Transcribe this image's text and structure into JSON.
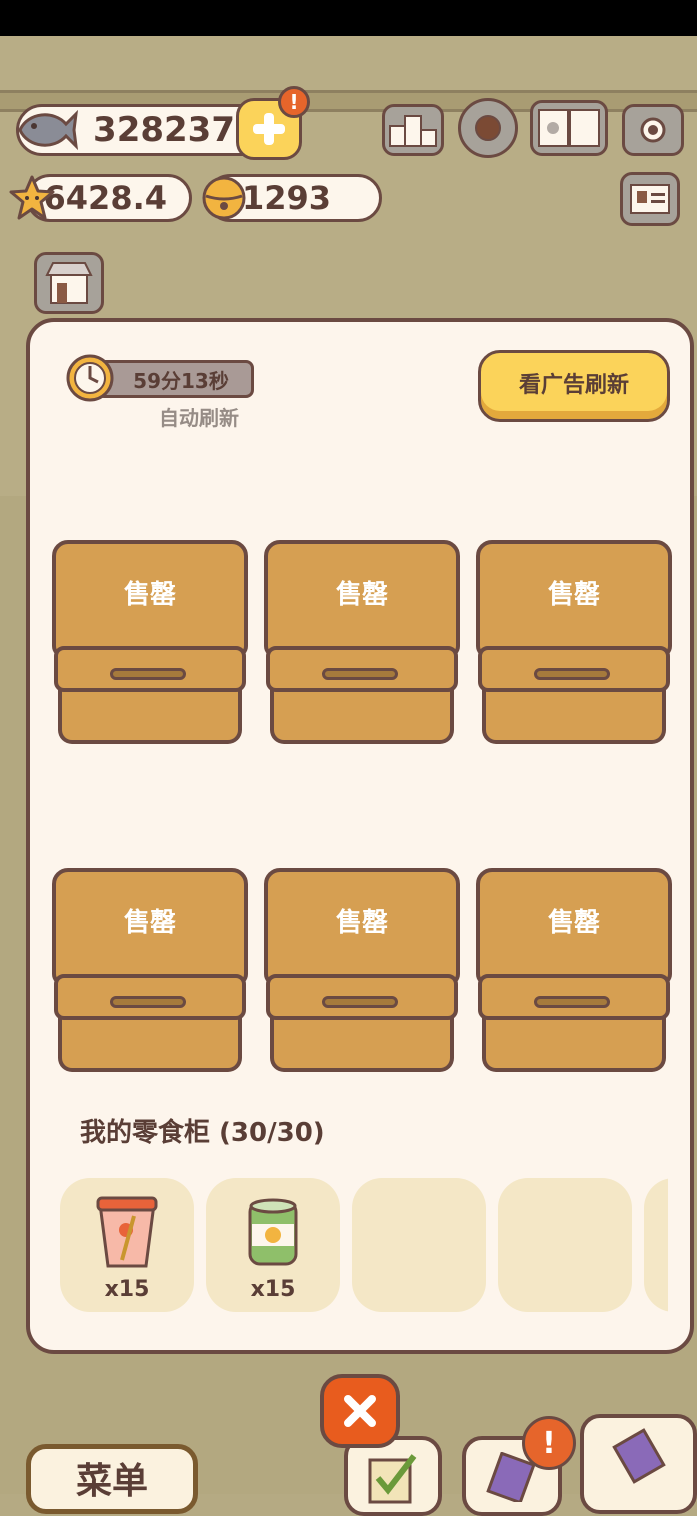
{
  "resources": {
    "fish": "328237",
    "star": "6428.4",
    "bell": "1293"
  },
  "toolbar": {
    "alert_mark": "!"
  },
  "shop": {
    "timer": "59分13秒",
    "auto_refresh_label": "自动刷新",
    "ad_refresh_label": "看广告刷新",
    "slots": [
      {
        "label": "售罄"
      },
      {
        "label": "售罄"
      },
      {
        "label": "售罄"
      },
      {
        "label": "售罄"
      },
      {
        "label": "售罄"
      },
      {
        "label": "售罄"
      }
    ]
  },
  "cabinet": {
    "title": "我的零食柜 (30/30)",
    "items": [
      {
        "qty": "x15",
        "icon": "cup-noodle-icon"
      },
      {
        "qty": "x15",
        "icon": "canned-food-icon"
      },
      {
        "qty": "",
        "icon": ""
      },
      {
        "qty": "",
        "icon": ""
      },
      {
        "qty": "",
        "icon": ""
      }
    ]
  },
  "bottom": {
    "menu_label": "菜单",
    "alert_mark": "!"
  },
  "colors": {
    "accent_yellow": "#fbd35a",
    "box_brown": "#d69f52",
    "outline": "#6b4a42",
    "close_orange": "#e85c1e",
    "panel_bg": "#fdf5ec"
  }
}
